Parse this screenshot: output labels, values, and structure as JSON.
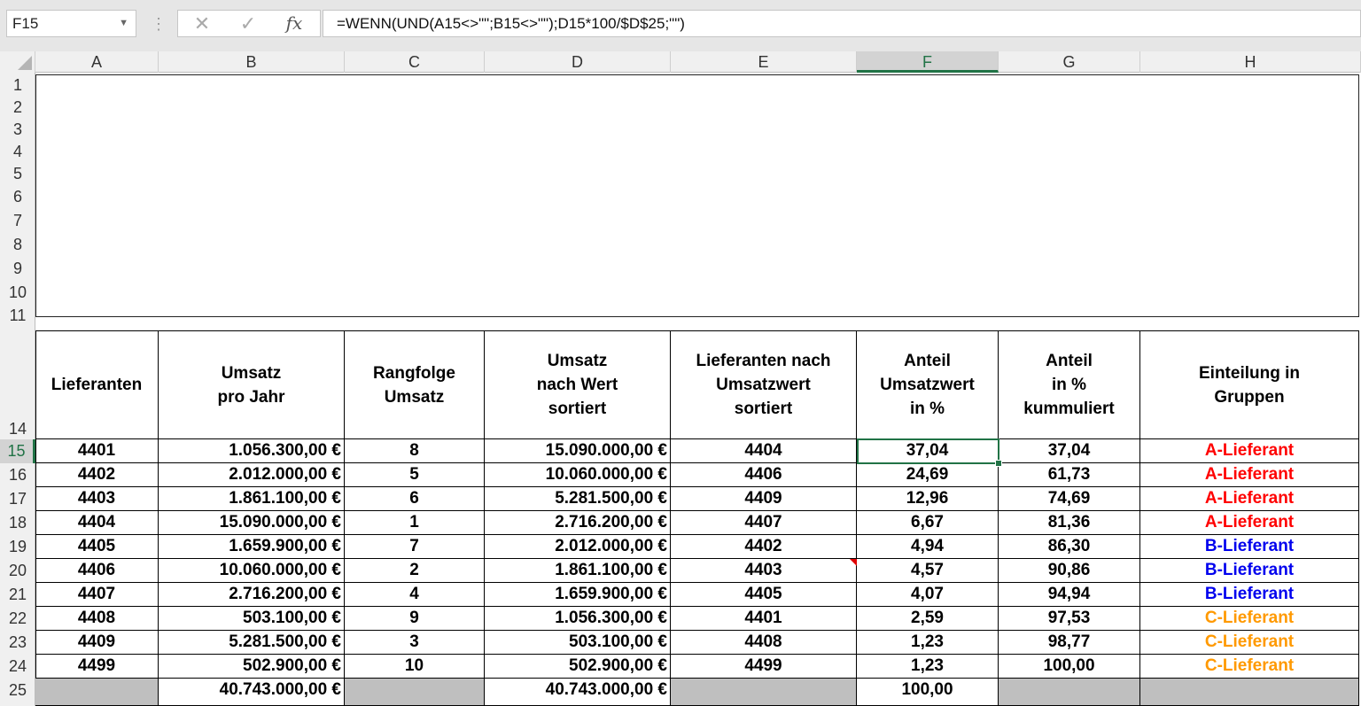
{
  "formula_bar": {
    "name_box": "F15",
    "separator": "⋮",
    "cancel_icon": "✕",
    "enter_icon": "✓",
    "fx_label": "fx",
    "formula": "=WENN(UND(A15<>\"\";B15<>\"\");D15*100/$D$25;\"\")"
  },
  "columns": [
    "A",
    "B",
    "C",
    "D",
    "E",
    "F",
    "G",
    "H"
  ],
  "rows_top": [
    "1",
    "2",
    "3",
    "4",
    "5",
    "6",
    "7",
    "8",
    "9",
    "10",
    "11"
  ],
  "header_row_number": "14",
  "headers": {
    "a": [
      "Lieferanten"
    ],
    "b": [
      "Umsatz",
      "pro Jahr"
    ],
    "c": [
      "Rangfolge",
      "Umsatz"
    ],
    "d": [
      "Umsatz",
      "nach Wert",
      "sortiert"
    ],
    "e": [
      "Lieferanten nach",
      "Umsatzwert",
      "sortiert"
    ],
    "f": [
      "Anteil",
      "Umsatzwert",
      "in %"
    ],
    "g": [
      "Anteil",
      "in %",
      "kummuliert"
    ],
    "h": [
      "Einteilung in",
      "Gruppen"
    ]
  },
  "data_rows": [
    {
      "row": "15",
      "a": "4401",
      "b": "1.056.300,00 €",
      "c": "8",
      "d": "15.090.000,00 €",
      "e": "4404",
      "f": "37,04",
      "g": "37,04",
      "h": "A-Lieferant",
      "group": "A"
    },
    {
      "row": "16",
      "a": "4402",
      "b": "2.012.000,00 €",
      "c": "5",
      "d": "10.060.000,00 €",
      "e": "4406",
      "f": "24,69",
      "g": "61,73",
      "h": "A-Lieferant",
      "group": "A"
    },
    {
      "row": "17",
      "a": "4403",
      "b": "1.861.100,00 €",
      "c": "6",
      "d": "5.281.500,00 €",
      "e": "4409",
      "f": "12,96",
      "g": "74,69",
      "h": "A-Lieferant",
      "group": "A"
    },
    {
      "row": "18",
      "a": "4404",
      "b": "15.090.000,00 €",
      "c": "1",
      "d": "2.716.200,00 €",
      "e": "4407",
      "f": "6,67",
      "g": "81,36",
      "h": "A-Lieferant",
      "group": "A"
    },
    {
      "row": "19",
      "a": "4405",
      "b": "1.659.900,00 €",
      "c": "7",
      "d": "2.012.000,00 €",
      "e": "4402",
      "f": "4,94",
      "g": "86,30",
      "h": "B-Lieferant",
      "group": "B"
    },
    {
      "row": "20",
      "a": "4406",
      "b": "10.060.000,00 €",
      "c": "2",
      "d": "1.861.100,00 €",
      "e": "4403",
      "f": "4,57",
      "g": "90,86",
      "h": "B-Lieferant",
      "group": "B"
    },
    {
      "row": "21",
      "a": "4407",
      "b": "2.716.200,00 €",
      "c": "4",
      "d": "1.659.900,00 €",
      "e": "4405",
      "f": "4,07",
      "g": "94,94",
      "h": "B-Lieferant",
      "group": "B"
    },
    {
      "row": "22",
      "a": "4408",
      "b": "503.100,00 €",
      "c": "9",
      "d": "1.056.300,00 €",
      "e": "4401",
      "f": "2,59",
      "g": "97,53",
      "h": "C-Lieferant",
      "group": "C"
    },
    {
      "row": "23",
      "a": "4409",
      "b": "5.281.500,00 €",
      "c": "3",
      "d": "503.100,00 €",
      "e": "4408",
      "f": "1,23",
      "g": "98,77",
      "h": "C-Lieferant",
      "group": "C"
    },
    {
      "row": "24",
      "a": "4499",
      "b": "502.900,00 €",
      "c": "10",
      "d": "502.900,00 €",
      "e": "4499",
      "f": "1,23",
      "g": "100,00",
      "h": "C-Lieferant",
      "group": "C"
    }
  ],
  "total_row": {
    "row": "25",
    "b": "40.743.000,00 €",
    "d": "40.743.000,00 €",
    "f": "100,00"
  },
  "group_colors": {
    "A": "#ff0000",
    "B": "#0000ee",
    "C": "#ff9900"
  },
  "accent_color": "#217346",
  "selected_cell": "F15"
}
